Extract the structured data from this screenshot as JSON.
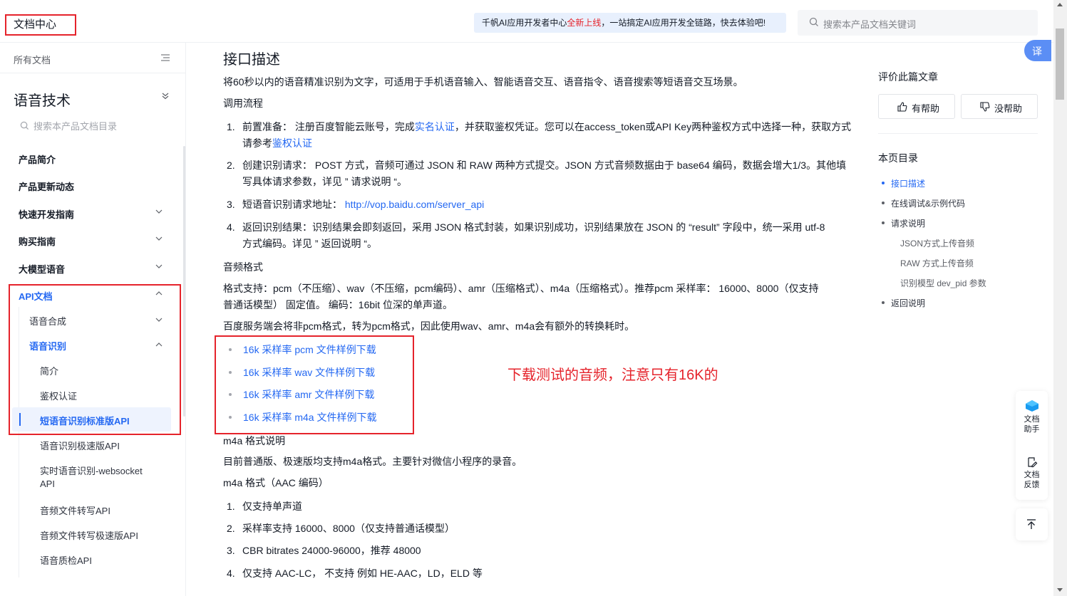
{
  "header": {
    "logo_text": "文档中心",
    "banner_prefix": "千帆AI应用开发者中心",
    "banner_highlight": "全新上线",
    "banner_suffix": "，一站搞定AI应用开发全链路，快去体验吧!",
    "search_placeholder": "搜索本产品文档关键词"
  },
  "sidebar": {
    "all_docs": "所有文档",
    "product_title": "语音技术",
    "search_placeholder": "搜索本产品文档目录",
    "items": [
      {
        "label": "产品简介"
      },
      {
        "label": "产品更新动态"
      },
      {
        "label": "快速开发指南"
      },
      {
        "label": "购买指南"
      },
      {
        "label": "大模型语音"
      },
      {
        "label": "API文档"
      },
      {
        "label": "语音合成"
      },
      {
        "label": "语音识别"
      },
      {
        "label": "简介"
      },
      {
        "label": "鉴权认证"
      },
      {
        "label": "短语音识别标准版API"
      },
      {
        "label": "语音识别极速版API"
      },
      {
        "label": "实时语音识别-websocket"
      },
      {
        "label": "API"
      },
      {
        "label": "音频文件转写API"
      },
      {
        "label": "音频文件转写极速版API"
      },
      {
        "label": "语音质检API"
      }
    ]
  },
  "main": {
    "title": "接口描述",
    "intro": "将60秒以内的语音精准识别为文字，可适用于手机语音输入、智能语音交互、语音指令、语音搜索等短语音交互场景。",
    "flow_heading": "调用流程",
    "steps": [
      {
        "num": "1.",
        "a": "前置准备： 注册百度智能云账号，完成",
        "link": "实名认证",
        "b": "，并获取鉴权凭证。您可以在access_token或API Key两种鉴权方式中选择一种，获取方式",
        "c": "请参考",
        "link2": "鉴权认证"
      },
      {
        "num": "2.",
        "a": "创建识别请求： POST 方式，音频可通过 JSON 和 RAW 两种方式提交。JSON 方式音频数据由于 base64 编码，数据会增大1/3。其他填",
        "b": "写具体请求参数，详见 ” 请求说明 “。"
      },
      {
        "num": "3.",
        "a": "短语音识别请求地址： ",
        "link": "http://vop.baidu.com/server_api"
      },
      {
        "num": "4.",
        "a": "返回识别结果：识别结果会即刻返回，采用 JSON 格式封装，如果识别成功，识别结果放在 JSON 的 “result” 字段中，统一采用 utf-8",
        "b": "方式编码。详见 ” 返回说明 “。"
      }
    ],
    "audio_heading": "音频格式",
    "format_line1": "格式支持：pcm（不压缩）、wav（不压缩，pcm编码）、amr（压缩格式）、m4a（压缩格式）。推荐pcm 采样率： 16000、8000（仅支持",
    "format_line2": "普通话模型） 固定值。 编码：16bit 位深的单声道。",
    "convert_note": "百度服务端会将非pcm格式，转为pcm格式，因此使用wav、amr、m4a会有额外的转换耗时。",
    "downloads": [
      "16k 采样率 pcm 文件样例下载",
      "16k 采样率 wav 文件样例下载",
      "16k 采样率 amr 文件样例下载",
      "16k 采样率 m4a 文件样例下载"
    ],
    "annotation": "下载测试的音频，注意只有16K的",
    "m4a_heading": "m4a 格式说明",
    "m4a_note": "目前普通版、极速版均支持m4a格式。主要针对微信小程序的录音。",
    "m4a_aac": "m4a 格式（AAC 编码）",
    "m4a_list": [
      {
        "num": "1.",
        "text": "仅支持单声道"
      },
      {
        "num": "2.",
        "text": "采样率支持 16000、8000（仅支持普通话模型）"
      },
      {
        "num": "3.",
        "text": "CBR bitrates 24000-96000，推荐 48000"
      },
      {
        "num": "4.",
        "text": "仅支持 AAC-LC， 不支持 例如 HE-AAC，LD，ELD 等"
      }
    ]
  },
  "right": {
    "rate_title": "评价此篇文章",
    "helpful": "有帮助",
    "not_helpful": "没帮助",
    "toc_title": "本页目录",
    "toc": [
      "接口描述",
      "在线调试&示例代码",
      "请求说明",
      "JSON方式上传音频",
      "RAW 方式上传音频",
      "识别模型 dev_pid 参数",
      "返回说明"
    ]
  },
  "tools": {
    "translate": "译",
    "assistant_1": "文档",
    "assistant_2": "助手",
    "feedback_1": "文档",
    "feedback_2": "反馈"
  },
  "colors": {
    "accent": "#2468f2",
    "annotation_red": "#e5232b"
  }
}
